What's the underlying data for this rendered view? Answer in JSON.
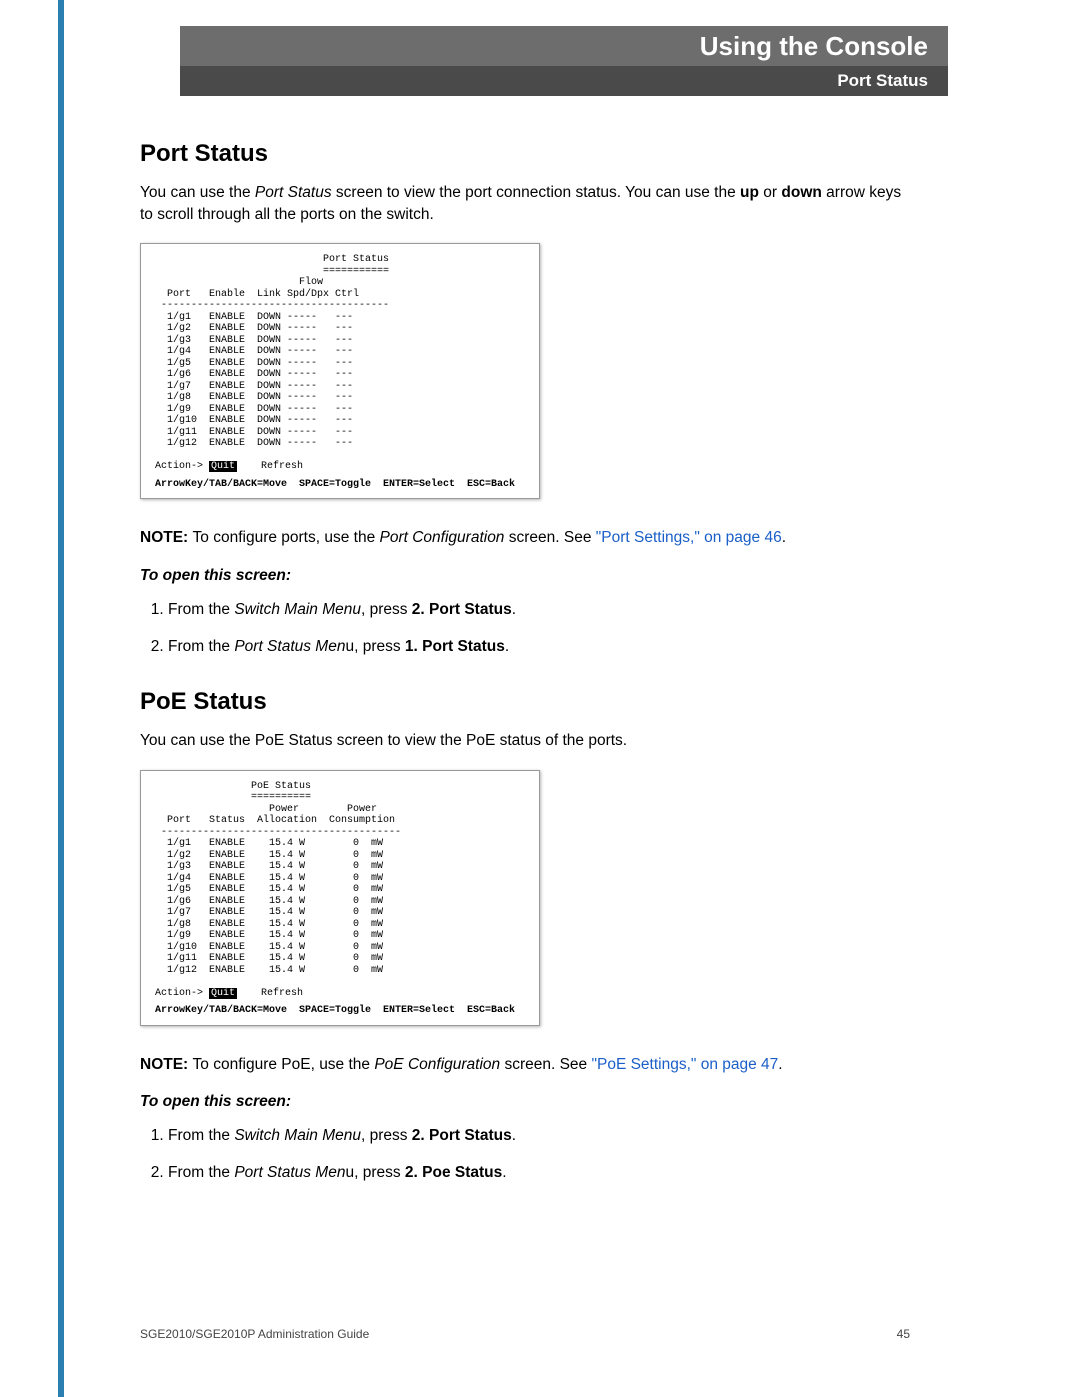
{
  "header": {
    "chapter": "Using the Console",
    "section": "Port Status"
  },
  "port_status": {
    "heading": "Port Status",
    "intro_pre": "You can use the ",
    "intro_scr": "Port Status",
    "intro_mid": " screen to view the port connection status. You can use the ",
    "up": "up",
    "intro_or": " or ",
    "down": "down",
    "intro_post": " arrow keys to scroll through all the ports on the switch.",
    "note_pre": "NOTE: ",
    "note_mid1": "To configure ports, use the ",
    "note_scr": "Port Configuration",
    "note_mid2": " screen. See ",
    "note_link": "\"Port Settings,\" on page 46",
    "note_end": ".",
    "to_open": "To open this screen:",
    "step1_pre": "From the ",
    "step1_menu": "Switch Main Menu",
    "step1_mid": ", press ",
    "step1_bold": "2. Port Status",
    "step1_end": ".",
    "step2_pre": "From the ",
    "step2_menu": "Port Status Men",
    "step2_u": "u, press ",
    "step2_bold": "1. Port Status",
    "step2_end": "."
  },
  "poe_status": {
    "heading": "PoE Status",
    "intro": "You can use the PoE Status screen to view the PoE status of the ports.",
    "note_pre": "NOTE: ",
    "note_mid1": "To configure PoE, use the ",
    "note_scr": "PoE Configuration",
    "note_mid2": " screen. See ",
    "note_link": "\"PoE Settings,\" on page 47",
    "note_end": ".",
    "to_open": "To open this screen:",
    "step1_pre": "From the ",
    "step1_menu": "Switch Main Menu",
    "step1_mid": ", press ",
    "step1_bold": "2. Port Status",
    "step1_end": ".",
    "step2_pre": "From the ",
    "step2_menu": "Port Status Men",
    "step2_u": "u, press ",
    "step2_bold": "2. Poe Status",
    "step2_end": "."
  },
  "console1": {
    "title": "Port Status",
    "underline": "===========",
    "cols": "                        Flow\n  Port   Enable  Link Spd/Dpx Ctrl",
    "sep": " --------------------------------------",
    "rows": [
      "  1/g1   ENABLE  DOWN -----   ---",
      "  1/g2   ENABLE  DOWN -----   ---",
      "  1/g3   ENABLE  DOWN -----   ---",
      "  1/g4   ENABLE  DOWN -----   ---",
      "  1/g5   ENABLE  DOWN -----   ---",
      "  1/g6   ENABLE  DOWN -----   ---",
      "  1/g7   ENABLE  DOWN -----   ---",
      "  1/g8   ENABLE  DOWN -----   ---",
      "  1/g9   ENABLE  DOWN -----   ---",
      "  1/g10  ENABLE  DOWN -----   ---",
      "  1/g11  ENABLE  DOWN -----   ---",
      "  1/g12  ENABLE  DOWN -----   ---"
    ],
    "action_pre": "Action-> ",
    "action_quit": "Quit",
    "action_post": "    Refresh",
    "footer": "ArrowKey/TAB/BACK=Move  SPACE=Toggle  ENTER=Select  ESC=Back"
  },
  "console2": {
    "title": "PoE Status",
    "underline": "==========",
    "cols": "                   Power        Power\n  Port   Status  Allocation  Consumption",
    "sep": " ----------------------------------------",
    "rows": [
      "  1/g1   ENABLE    15.4 W        0  mW",
      "  1/g2   ENABLE    15.4 W        0  mW",
      "  1/g3   ENABLE    15.4 W        0  mW",
      "  1/g4   ENABLE    15.4 W        0  mW",
      "  1/g5   ENABLE    15.4 W        0  mW",
      "  1/g6   ENABLE    15.4 W        0  mW",
      "  1/g7   ENABLE    15.4 W        0  mW",
      "  1/g8   ENABLE    15.4 W        0  mW",
      "  1/g9   ENABLE    15.4 W        0  mW",
      "  1/g10  ENABLE    15.4 W        0  mW",
      "  1/g11  ENABLE    15.4 W        0  mW",
      "  1/g12  ENABLE    15.4 W        0  mW"
    ],
    "action_pre": "Action-> ",
    "action_quit": "Quit",
    "action_post": "    Refresh",
    "footer": "ArrowKey/TAB/BACK=Move  SPACE=Toggle  ENTER=Select  ESC=Back"
  },
  "footer": {
    "left": "SGE2010/SGE2010P Administration Guide",
    "right": "45"
  }
}
